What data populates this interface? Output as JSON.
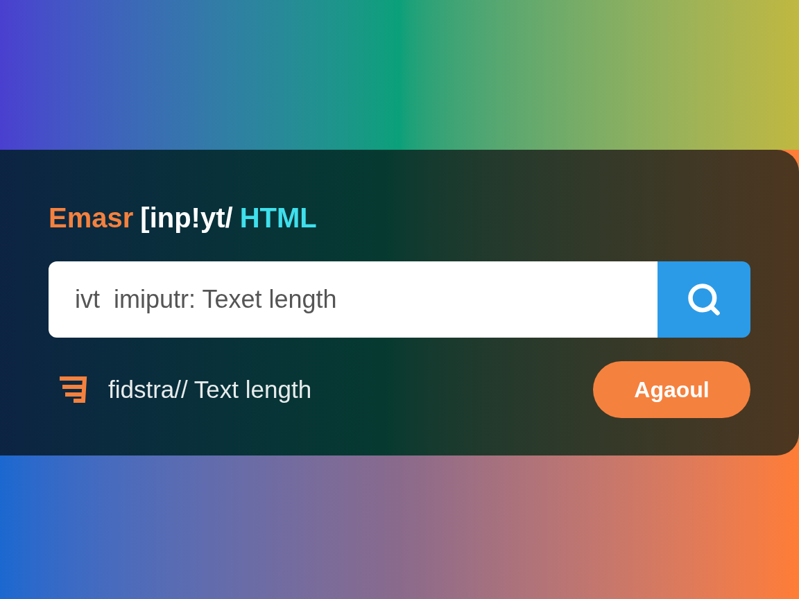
{
  "title_parts": [
    {
      "text": "Emasr",
      "color": "#f5813e"
    },
    {
      "text": "[inp!yt/",
      "color": "#ffffff"
    },
    {
      "text": "HTML",
      "color": "#3fe0ec"
    }
  ],
  "search": {
    "value": "ivt  imiputr: Texet length"
  },
  "footer": {
    "text": "fidstra// Text length",
    "button": "Agaoul"
  }
}
